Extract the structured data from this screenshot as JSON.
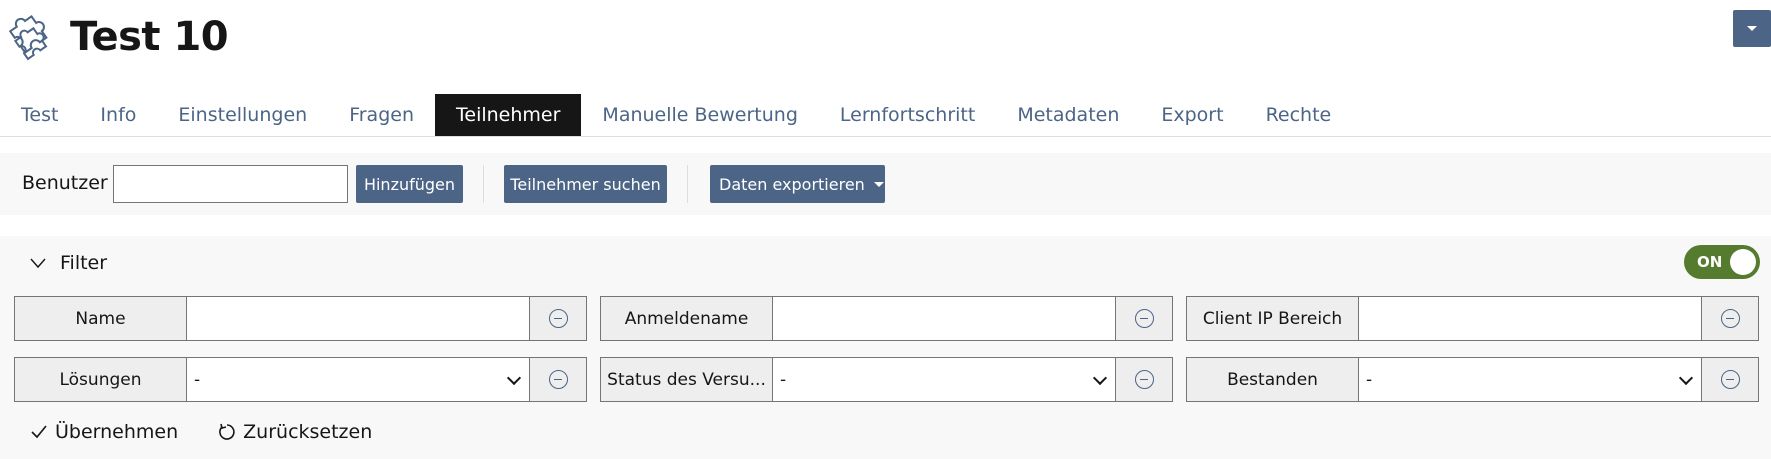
{
  "header": {
    "title": "Test 10",
    "icon": "puzzle-icon",
    "menu_icon": "caret-down-icon"
  },
  "tabs": [
    {
      "label": "Test"
    },
    {
      "label": "Info"
    },
    {
      "label": "Einstellungen"
    },
    {
      "label": "Fragen"
    },
    {
      "label": "Teilnehmer",
      "active": true
    },
    {
      "label": "Manuelle Bewertung"
    },
    {
      "label": "Lernfortschritt"
    },
    {
      "label": "Metadaten"
    },
    {
      "label": "Export"
    },
    {
      "label": "Rechte"
    }
  ],
  "toolbar": {
    "user_label": "Benutzer",
    "user_value": "",
    "add_label": "Hinzufügen",
    "search_label": "Teilnehmer suchen",
    "export_label": "Daten exportieren"
  },
  "filter": {
    "title": "Filter",
    "toggle_label": "ON",
    "fields": {
      "name": {
        "label": "Name",
        "value": ""
      },
      "login": {
        "label": "Anmeldename",
        "value": ""
      },
      "ip": {
        "label": "Client IP Bereich",
        "value": ""
      },
      "solutions": {
        "label": "Lösungen",
        "value": "-"
      },
      "status": {
        "label": "Status des Versu...",
        "value": "-"
      },
      "passed": {
        "label": "Bestanden",
        "value": "-"
      }
    },
    "apply_label": "Übernehmen",
    "reset_label": "Zurücksetzen"
  },
  "colors": {
    "accent": "#4c6586",
    "active_tab": "#161616",
    "toggle_on": "#557b2e"
  }
}
